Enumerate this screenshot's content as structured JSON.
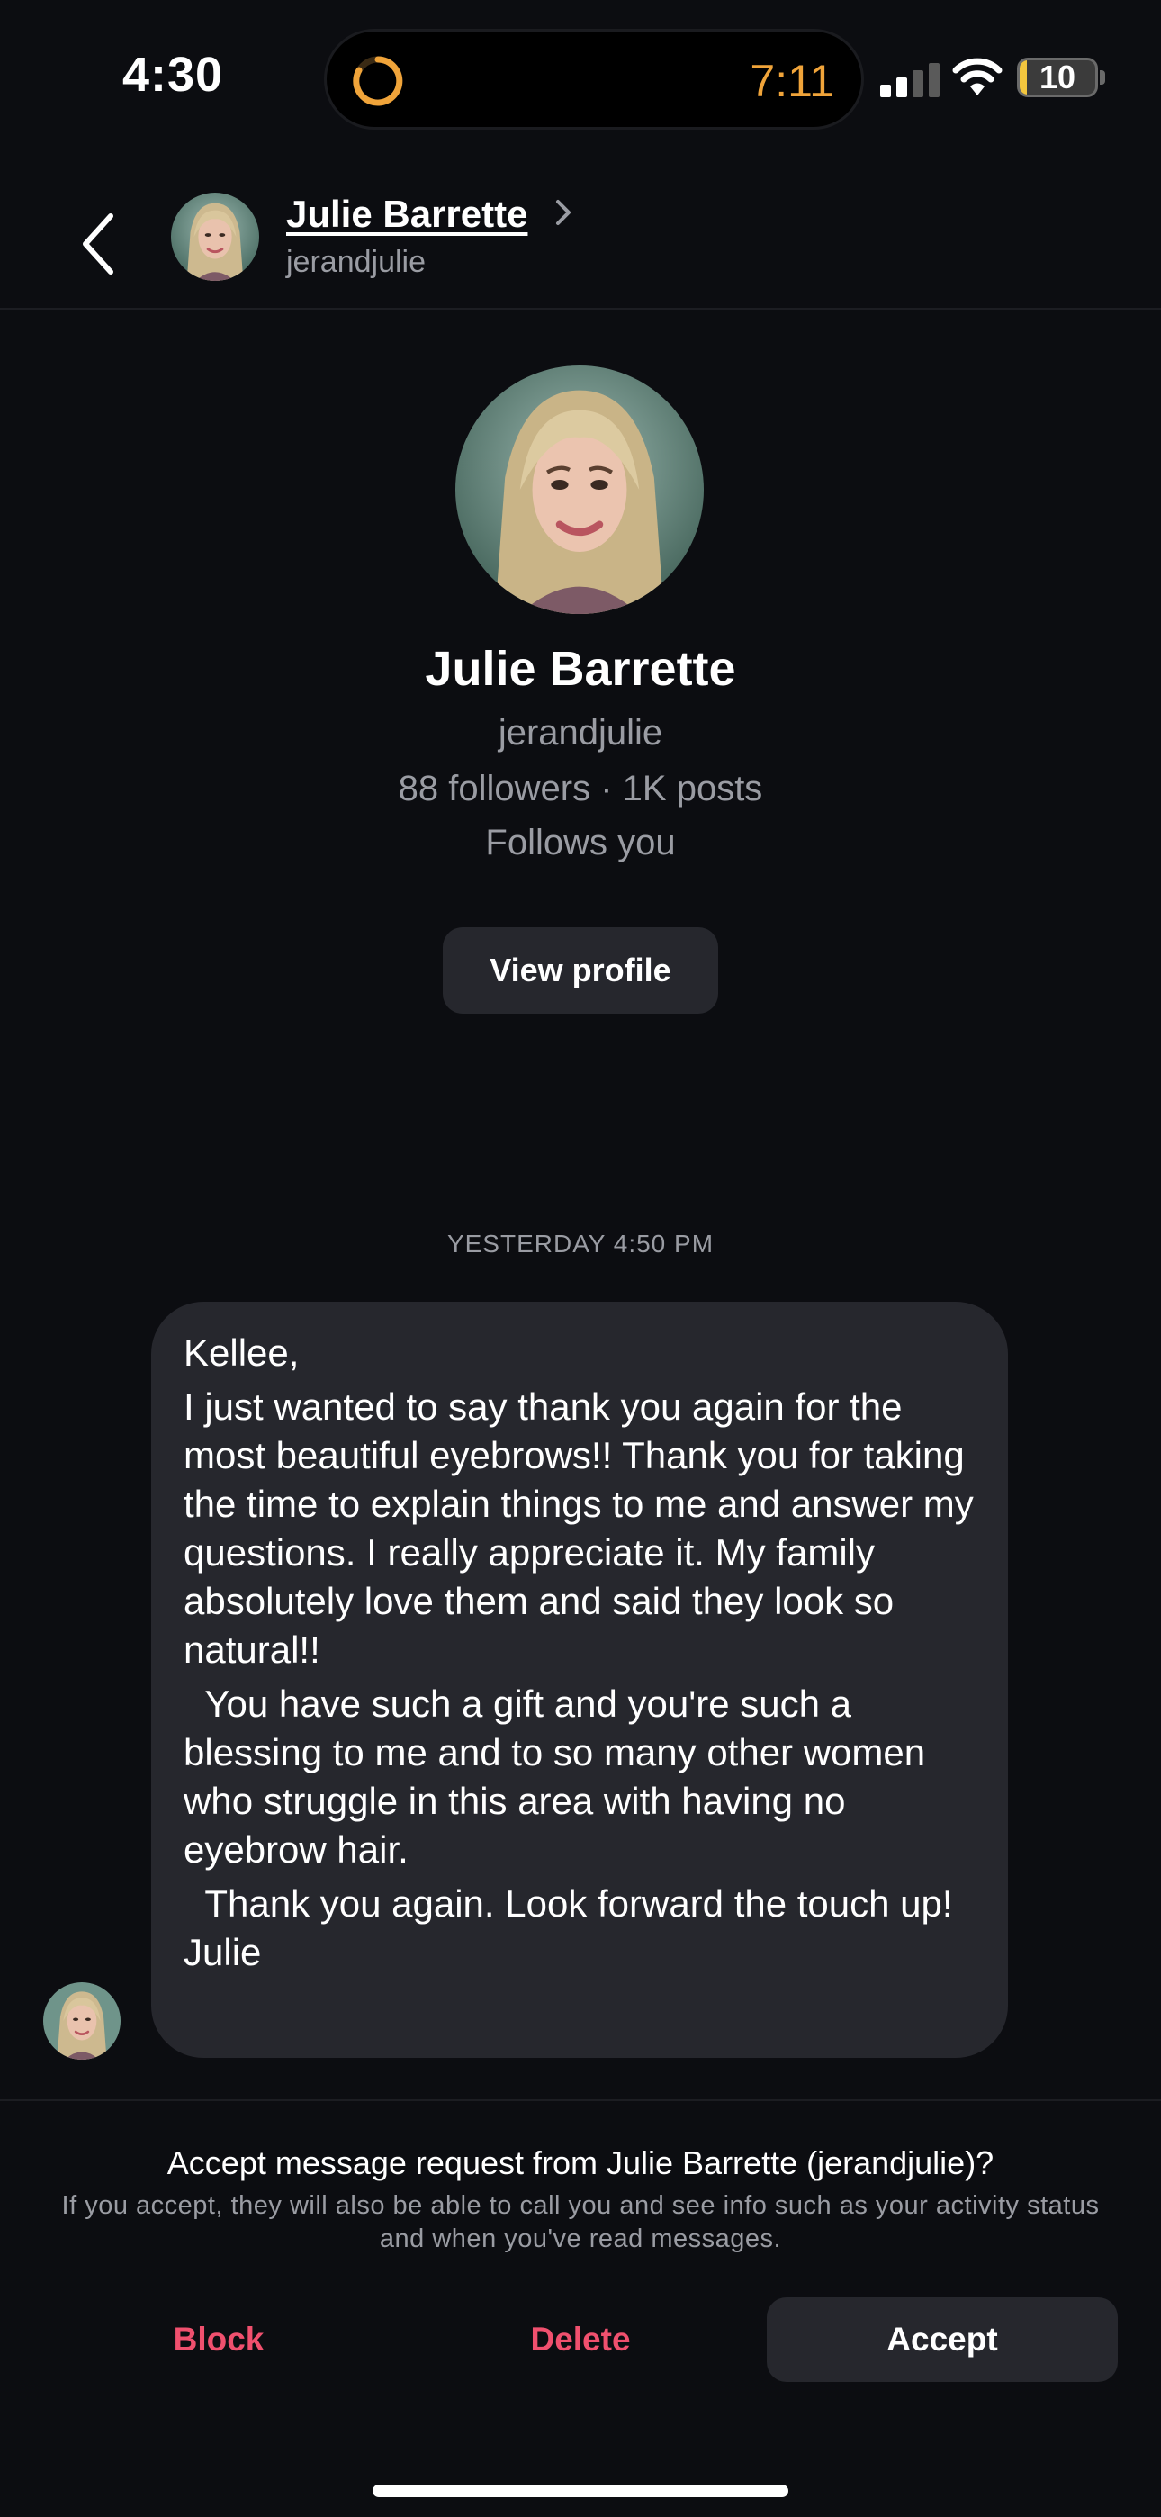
{
  "status_bar": {
    "time": "4:30",
    "timer": "7:11",
    "battery": "10",
    "battery_level": 0.1,
    "colors": {
      "timer": "#f0a43a",
      "battery": "#f3c63e"
    }
  },
  "header": {
    "name": "Julie Barrette",
    "handle": "jerandjulie"
  },
  "profile": {
    "name": "Julie Barrette",
    "handle": "jerandjulie",
    "stats": "88 followers · 1K posts",
    "follows_status": "Follows you",
    "view_profile_label": "View profile"
  },
  "conversation": {
    "timestamp": "YESTERDAY 4:50 PM",
    "message_paragraphs": [
      "Kellee,",
      "I just wanted to say thank you again for the most beautiful eyebrows!! Thank you for taking the time to explain things to me and answer my questions. I really appreciate it. My family absolutely love them and said they look so natural!!",
      "  You have such a gift and you're such a blessing to me and to so many other women who struggle in this area with having no eyebrow hair.",
      "  Thank you again. Look forward the touch up!\nJulie"
    ]
  },
  "request": {
    "title": "Accept message request from Julie Barrette (jerandjulie)?",
    "subtitle": "If you accept, they will also be able to call you and see info such as your activity status and when you've read messages.",
    "block_label": "Block",
    "delete_label": "Delete",
    "accept_label": "Accept",
    "colors": {
      "destructive": "#f0506e",
      "button_bg": "#26272d"
    }
  }
}
